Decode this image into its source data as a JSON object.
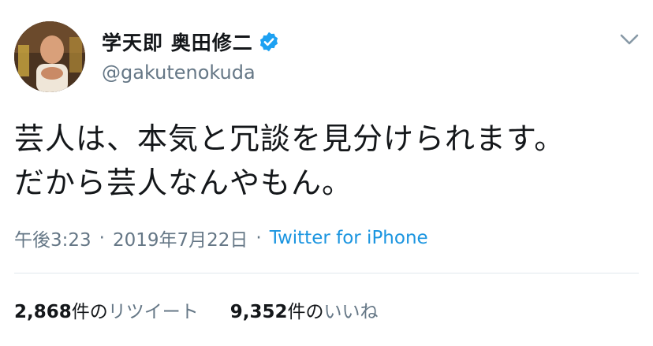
{
  "user": {
    "display_name": "学天即 奥田修二",
    "handle": "@gakutenokuda",
    "verified": true,
    "verified_color": "#1da1f2"
  },
  "tweet": {
    "lines": [
      "芸人は、本気と冗談を見分けられます。",
      "だから芸人なんやもん。"
    ]
  },
  "meta": {
    "time": "午後3:23",
    "date": "2019年7月22日",
    "separator": "·",
    "source": "Twitter for iPhone",
    "source_color": "#1b95e0"
  },
  "stats": {
    "retweets": {
      "count": "2,868",
      "unit": "件の",
      "label": "リツイート"
    },
    "likes": {
      "count": "9,352",
      "unit": "件の",
      "label": "いいね"
    }
  },
  "icons": {
    "verified": "verified-badge-icon",
    "menu": "chevron-down-icon"
  }
}
